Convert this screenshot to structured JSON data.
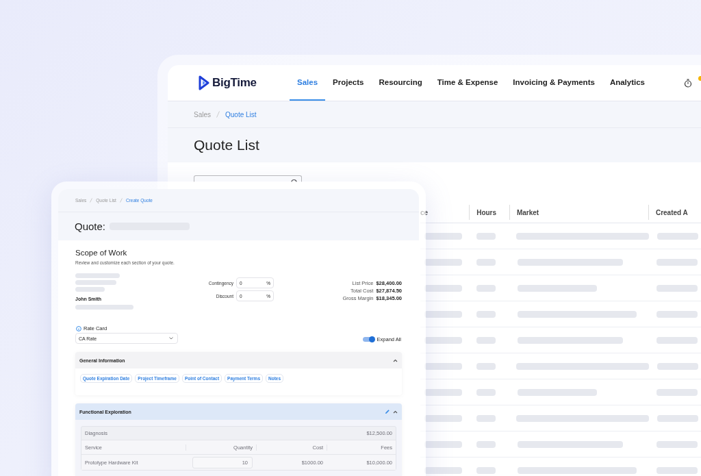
{
  "back_window": {
    "logo": "BigTime",
    "nav": [
      {
        "label": "Sales",
        "selected": true
      },
      {
        "label": "Projects",
        "selected": false
      },
      {
        "label": "Resourcing",
        "selected": false
      },
      {
        "label": "Time & Expense",
        "selected": false
      },
      {
        "label": "Invoicing & Payments",
        "selected": false
      },
      {
        "label": "Analytics",
        "selected": false
      }
    ],
    "breadcrumb": [
      {
        "label": "Sales",
        "current": false
      },
      {
        "label": "Quote List",
        "current": true
      }
    ],
    "title": "Quote List",
    "table": {
      "columns": [
        "ce",
        "Hours",
        "Market",
        "Created A"
      ]
    }
  },
  "front_window": {
    "breadcrumb": [
      {
        "label": "Sales",
        "current": false
      },
      {
        "label": "Quote List",
        "current": false
      },
      {
        "label": "Create Quote",
        "current": true
      }
    ],
    "title": "Quote:",
    "section_title": "Scope of Work",
    "description": "Review and customize each section of your quote.",
    "contact_name": "John Smith",
    "adjustments": [
      {
        "label": "Contingency",
        "value": "0",
        "unit": "%"
      },
      {
        "label": "Discount",
        "value": "0",
        "unit": "%"
      }
    ],
    "totals": [
      {
        "label": "List Price",
        "value": "$28,400.00"
      },
      {
        "label": "Total Cost",
        "value": "$27,874.50"
      },
      {
        "label": "Gross Margin",
        "value": "$18,345.00"
      }
    ],
    "rate_card": {
      "label": "Rate Card",
      "value": "CA Rate"
    },
    "expand_all": {
      "label": "Expand All",
      "on": true
    },
    "sections": [
      {
        "title": "General Information",
        "expanded": true,
        "highlighted": false,
        "editable": false,
        "chips": [
          "Quote Expiration Date",
          "Project Timeframe",
          "Point of Contact",
          "Payment Terms",
          "Notes"
        ]
      },
      {
        "title": "Functional Exploration",
        "expanded": true,
        "highlighted": true,
        "editable": true,
        "groups": [
          {
            "name": "Diagnosis",
            "total": "$12,500.00",
            "columns": [
              "Service",
              "Quantity",
              "Cost",
              "Fees"
            ],
            "rows": [
              {
                "service": "Prototype Hardware Kit",
                "quantity": "10",
                "cost": "$1000.00",
                "fees": "$10,000.00"
              }
            ]
          }
        ]
      }
    ]
  }
}
